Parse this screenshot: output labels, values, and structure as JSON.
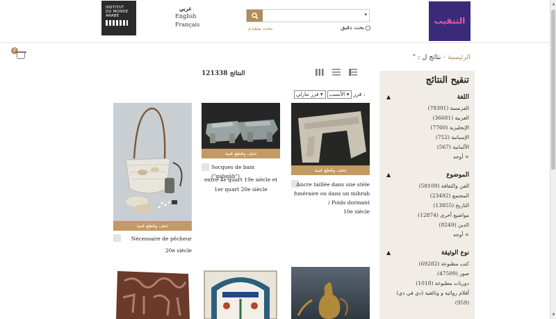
{
  "header": {
    "institute_logo": "INSTITUT DU MONDE ARABE",
    "languages": [
      "عربي",
      "English",
      "Français"
    ],
    "search_placeholder": "",
    "advanced_search": "بحث متقدم",
    "exact_search": "بحث دقيق",
    "brand_logo": "التنقيب"
  },
  "cart": {
    "count": "0"
  },
  "breadcrumb": {
    "home": "الرئيسية",
    "separator": "›",
    "current": "نتائج ل : \""
  },
  "results": {
    "count_label": "121338 النتائج"
  },
  "sort": {
    "label": "فرز :",
    "option1": "الأنسب",
    "option2": "فرز تنازلي"
  },
  "sidebar": {
    "title": "تنقيح النتائج",
    "facets": [
      {
        "name": "اللغة",
        "items": [
          "الفرنسية (78391)",
          "العربية (36681)",
          "الإنجليزية (7760)",
          "الإسبانية (752)",
          "الألمانية (567)"
        ],
        "more": "+ أوجه"
      },
      {
        "name": "الموضوع",
        "items": [
          "الفن والثقافة (58109)",
          "المجتمع (23492)",
          "التاريخ (13855)",
          "مواضيع أخرى (12874)",
          "الدين (8249)"
        ],
        "more": "+ أوجه"
      },
      {
        "name": "نوع الوثيقة",
        "items": [
          "كتب مطبوعة (69282)",
          "صور (47509)",
          "دوريات مطبوعة (1018)",
          "أفلام روائية و وثائقية (دي في دي)",
          "(959)"
        ],
        "more": ""
      }
    ]
  },
  "cards": [
    {
      "band": "تحف وقطع فنية",
      "title": "Ancre taillée dans une stèle funéraire ou dans un mihrab / Poids dormant",
      "date": "10e siècle"
    },
    {
      "band": "تحف وقطع فنية",
      "title": "Socques de bain (\"qabqâb\")",
      "date": "entre 4e quart 19e siècle et 1er quart 20e siècle"
    },
    {
      "band": "تحف وقطع فنية",
      "title": "Nécessaire de pêcheur",
      "date": "20e siècle"
    }
  ],
  "colors": {
    "accent": "#b18c57",
    "band": "#c39a64",
    "sidebar_bg": "#f1ede6"
  }
}
